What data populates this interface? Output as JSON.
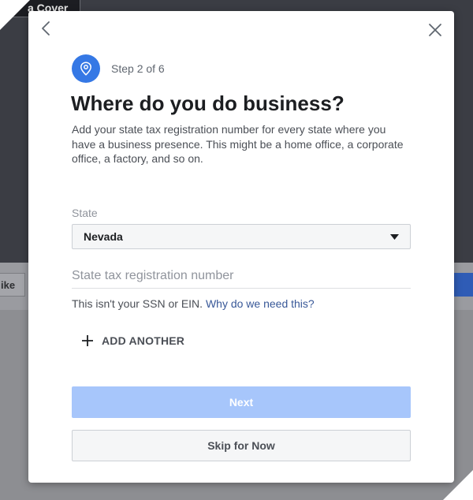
{
  "background": {
    "cover_button_label": "a Cover",
    "like_button_label": "ike"
  },
  "icons": {
    "back": "chevron-left-icon",
    "close": "close-icon",
    "step": "location-pin-icon",
    "dropdown": "caret-down-icon",
    "add": "plus-icon"
  },
  "colors": {
    "accent": "#3578e5",
    "next_disabled": "#a7c6fb",
    "link": "#385898"
  },
  "dialog": {
    "step_text": "Step 2 of 6",
    "title": "Where do you do business?",
    "description": "Add your state tax registration number for every state where you have a business presence. This might be a home office, a corporate office, a factory, and so on.",
    "state_label": "State",
    "state_value": "Nevada",
    "tax_field": {
      "value": "",
      "placeholder": "State tax registration number"
    },
    "hint_text": "This isn't your SSN or EIN.",
    "hint_link": "Why do we need this?",
    "add_another_label": "ADD ANOTHER",
    "next_label": "Next",
    "skip_label": "Skip for Now"
  }
}
